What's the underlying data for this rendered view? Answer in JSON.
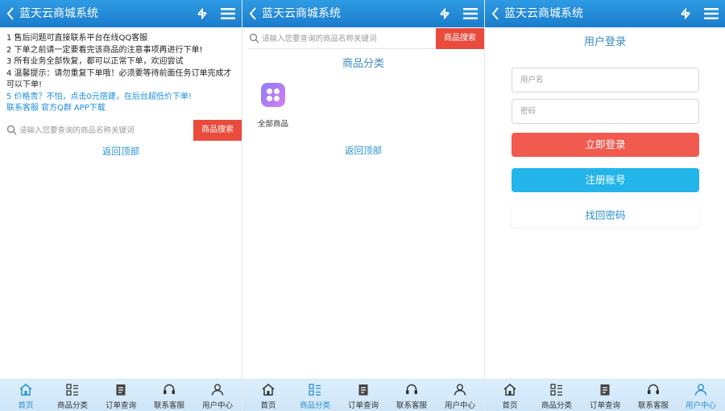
{
  "app": {
    "title": "蓝天云商城系统"
  },
  "tabs": [
    "首页",
    "商品分类",
    "订单查询",
    "联系客服",
    "用户中心"
  ],
  "colors": {
    "header": "#1a7ccc",
    "search_button": "#e94b3c",
    "login_button": "#f15a4e",
    "register_button": "#23b5ea",
    "link": "#2a8fd0"
  },
  "icons": [
    "back-icon",
    "swap-icon",
    "menu-icon",
    "search-icon",
    "home-icon",
    "category-icon",
    "order-icon",
    "headset-icon",
    "user-icon"
  ],
  "home": {
    "notices": [
      "1 售后问题可直接联系平台在线QQ客服",
      "2 下单之前请一定要看完该商品的注意事项再进行下单!",
      "3 所有业务全部恢复，都可以正常下单，欢迎尝试",
      "4 温馨提示：请勿重复下单哦！必须要等待前面任务订单完成才可以下单!",
      "5 价格贵？不怕，点击0元搭建，在后台超低价下单!"
    ],
    "links": [
      "联系客服",
      "官方Q群",
      "APP下载"
    ],
    "search_placeholder": "请输入您要查询的商品名称关键词",
    "search_button": "商品搜索",
    "back_to_top": "返回顶部",
    "active_tab": "首页"
  },
  "category": {
    "search_placeholder": "请输入您要查询的商品名称关键词",
    "search_button": "商品搜索",
    "title": "商品分类",
    "item_label": "全部商品",
    "back_to_top": "返回顶部",
    "active_tab": "商品分类"
  },
  "login": {
    "title": "用户登录",
    "username_placeholder": "用户名",
    "password_placeholder": "密码",
    "login_button": "立即登录",
    "register_button": "注册账号",
    "forgot_button": "找回密码",
    "active_tab": "用户中心"
  }
}
